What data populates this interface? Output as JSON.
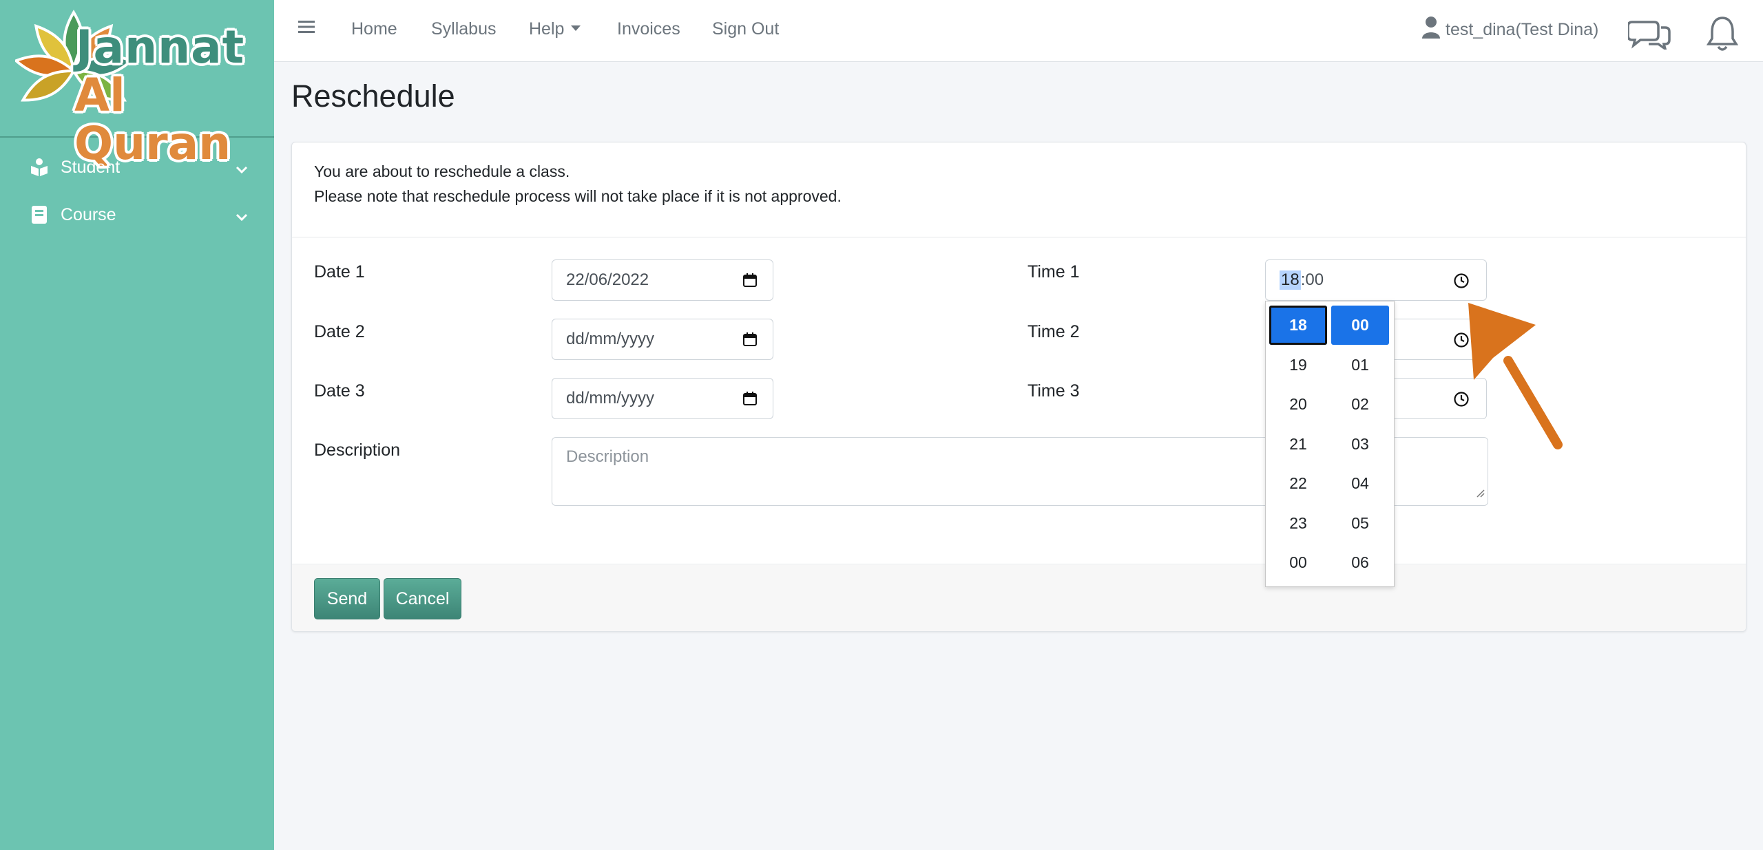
{
  "brand": {
    "line1": "Jannat",
    "line2": "Al Quran"
  },
  "sidebar": {
    "items": [
      {
        "label": "Student",
        "icon": "reader-icon"
      },
      {
        "label": "Course",
        "icon": "book-icon"
      }
    ]
  },
  "topbar": {
    "links": [
      "Home",
      "Syllabus",
      "Help",
      "Invoices",
      "Sign Out"
    ],
    "user": "test_dina(Test Dina)"
  },
  "page": {
    "title": "Reschedule",
    "notice_line1": "You are about to reschedule a class.",
    "notice_line2": "Please note that reschedule process will not take place if it is not approved."
  },
  "form": {
    "date1_label": "Date 1",
    "date2_label": "Date 2",
    "date3_label": "Date 3",
    "time1_label": "Time 1",
    "time2_label": "Time 2",
    "time3_label": "Time 3",
    "description_label": "Description",
    "date1_value": "22/06/2022",
    "date2_value": "dd/mm/yyyy",
    "date3_value": "dd/mm/yyyy",
    "time1_hours": "18",
    "time1_minutes": ":00",
    "description_placeholder": "Description",
    "send_label": "Send",
    "cancel_label": "Cancel"
  },
  "time_picker": {
    "hours": [
      "18",
      "19",
      "20",
      "21",
      "22",
      "23",
      "00"
    ],
    "minutes": [
      "00",
      "01",
      "02",
      "03",
      "04",
      "05",
      "06"
    ],
    "selected_hour": "18",
    "selected_minute": "00"
  },
  "colors": {
    "sidebar": "#6cc4b1",
    "button": "#4a9a87",
    "picker_selected": "#1a73e8",
    "annotation_arrow": "#d9731d"
  }
}
